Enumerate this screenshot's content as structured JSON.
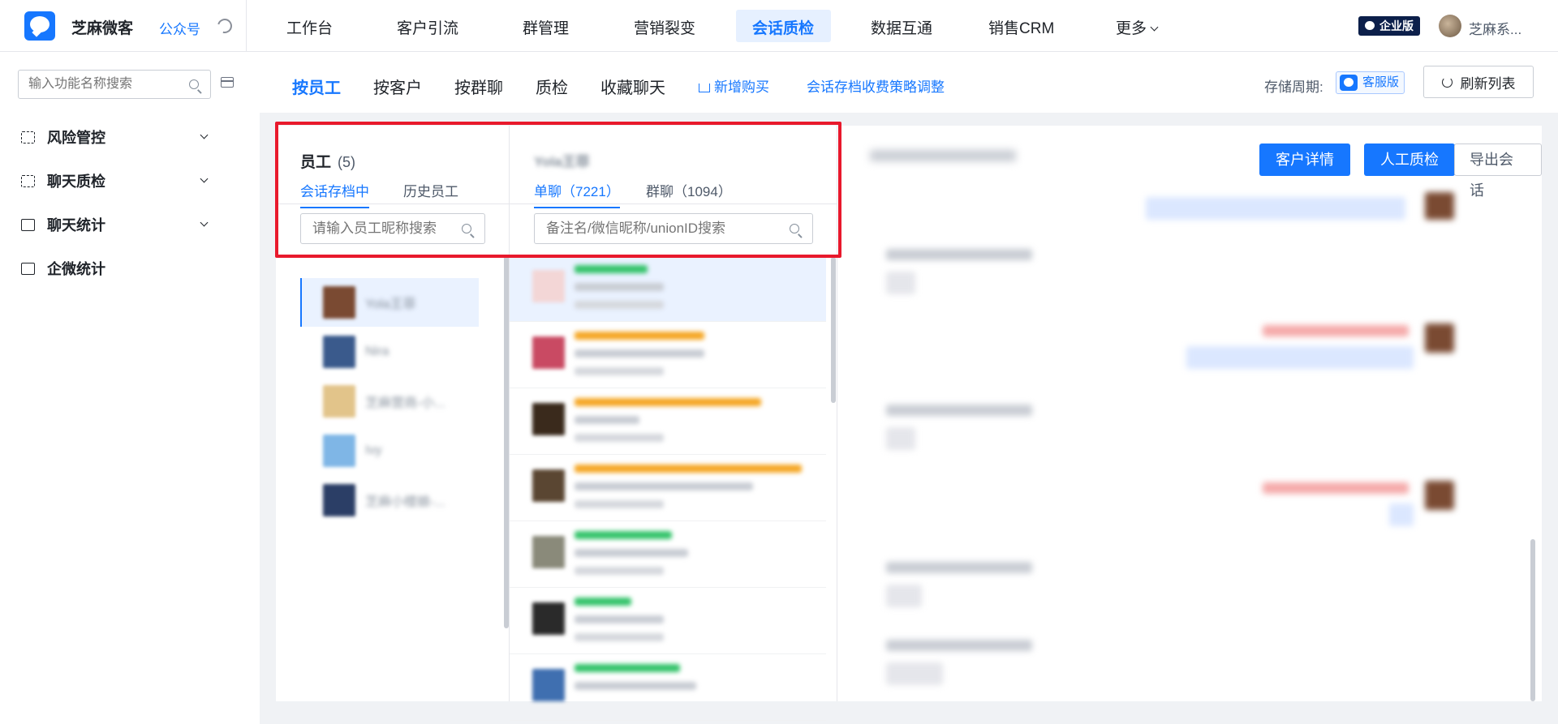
{
  "topbar": {
    "brand": "芝麻微客",
    "gzh_link": "公众号",
    "nav": [
      "工作台",
      "客户引流",
      "群管理",
      "营销裂变",
      "会话质检",
      "数据互通",
      "销售CRM",
      "更多"
    ],
    "active_nav": "会话质检",
    "enterprise_badge": "企业版",
    "user_name": "芝麻系..."
  },
  "sidebar": {
    "search_placeholder": "输入功能名称搜索",
    "items": [
      {
        "label": "风险管控",
        "icon": "scan-icon",
        "expandable": true
      },
      {
        "label": "聊天质检",
        "icon": "scan-icon",
        "expandable": true
      },
      {
        "label": "聊天统计",
        "icon": "chart-icon",
        "expandable": true
      },
      {
        "label": "企微统计",
        "icon": "chart-icon",
        "expandable": false
      }
    ]
  },
  "subbar": {
    "tabs": [
      "按员工",
      "按客户",
      "按群聊",
      "质检",
      "收藏聊天"
    ],
    "active_tab": "按员工",
    "buy_link": "新增购买",
    "policy_link": "会话存档收费策略调整",
    "storage_label": "存储周期:",
    "storage_badge": "客服版",
    "refresh_button": "刷新列表"
  },
  "employee_panel": {
    "title": "员工",
    "count": "(5)",
    "tabs": [
      "会话存档中",
      "历史员工"
    ],
    "active_tab": "会话存档中",
    "search_placeholder": "请输入员工昵称搜索",
    "employees": [
      {
        "name": "Yola王菲",
        "color": "#7a4a32",
        "selected": true
      },
      {
        "name": "Nira",
        "color": "#3a5a8c",
        "selected": false
      },
      {
        "name": "芝麻营商-小...",
        "color": "#e2c48a",
        "selected": false
      },
      {
        "name": "Ivy",
        "color": "#7fb6e6",
        "selected": false
      },
      {
        "name": "芝麻小楼娘-...",
        "color": "#2b3e66",
        "selected": false
      }
    ]
  },
  "chat_panel": {
    "title": "Yola王菲",
    "tabs": [
      "单聊（7221）",
      "群聊（1094）"
    ],
    "active_tab": "单聊（7221）",
    "search_placeholder": "备注名/微信昵称/unionID搜索",
    "rows": [
      {
        "color": "#f3d6d6",
        "tag": "#33c36a",
        "selected": true
      },
      {
        "color": "#c94a63",
        "tag": "#f5a623",
        "selected": false
      },
      {
        "color": "#3a2a1c",
        "tag": "#f5a623",
        "selected": false
      },
      {
        "color": "#5a4632",
        "tag": "#f5a623",
        "selected": false
      },
      {
        "color": "#8a8a7a",
        "tag": "#33c36a",
        "selected": false
      },
      {
        "color": "#2a2a2a",
        "tag": "#33c36a",
        "selected": false
      },
      {
        "color": "#3f6fb0",
        "tag": "#33c36a",
        "selected": false
      }
    ]
  },
  "conversation": {
    "customer_detail_button": "客户详情",
    "manual_check_button": "人工质检",
    "export_button": "导出会话"
  },
  "colors": {
    "primary": "#1677ff",
    "highlight": "#e8192c"
  }
}
